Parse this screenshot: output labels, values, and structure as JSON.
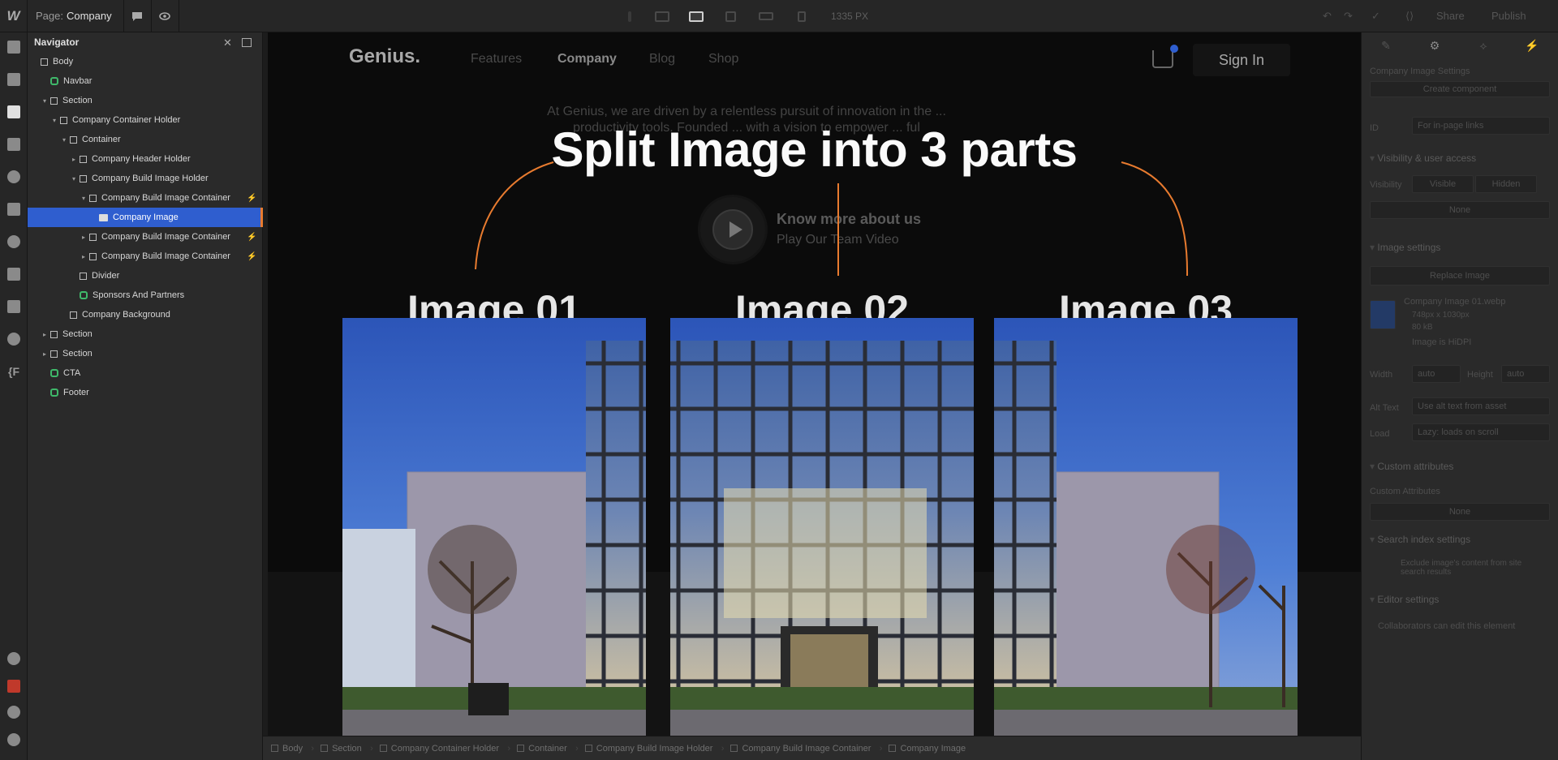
{
  "topbar": {
    "logo": "W",
    "page_prefix": "Page:",
    "page_name": "Company",
    "width_readout": "1335 PX",
    "share": "Share",
    "publish": "Publish"
  },
  "navigator": {
    "title": "Navigator",
    "tree": [
      {
        "label": "Body",
        "depth": 0,
        "kind": "box",
        "caret": ""
      },
      {
        "label": "Navbar",
        "depth": 1,
        "kind": "component",
        "caret": ""
      },
      {
        "label": "Section",
        "depth": 1,
        "kind": "box",
        "caret": "▾"
      },
      {
        "label": "Company Container Holder",
        "depth": 2,
        "kind": "box",
        "caret": "▾"
      },
      {
        "label": "Container",
        "depth": 3,
        "kind": "box",
        "caret": "▾"
      },
      {
        "label": "Company Header Holder",
        "depth": 4,
        "kind": "box",
        "caret": "▸"
      },
      {
        "label": "Company Build Image Holder",
        "depth": 4,
        "kind": "box",
        "caret": "▾"
      },
      {
        "label": "Company Build Image Container",
        "depth": 5,
        "kind": "box",
        "caret": "▾",
        "bolt": true
      },
      {
        "label": "Company Image",
        "depth": 6,
        "kind": "image",
        "caret": "",
        "selected": true
      },
      {
        "label": "Company Build Image Container",
        "depth": 5,
        "kind": "box",
        "caret": "▸",
        "bolt": true
      },
      {
        "label": "Company Build Image Container",
        "depth": 5,
        "kind": "box",
        "caret": "▸",
        "bolt": true
      },
      {
        "label": "Divider",
        "depth": 4,
        "kind": "box",
        "caret": ""
      },
      {
        "label": "Sponsors And Partners",
        "depth": 4,
        "kind": "component",
        "caret": ""
      },
      {
        "label": "Company Background",
        "depth": 3,
        "kind": "box",
        "caret": ""
      },
      {
        "label": "Section",
        "depth": 1,
        "kind": "box",
        "caret": "▸"
      },
      {
        "label": "Section",
        "depth": 1,
        "kind": "box",
        "caret": "▸"
      },
      {
        "label": "CTA",
        "depth": 1,
        "kind": "component",
        "caret": ""
      },
      {
        "label": "Footer",
        "depth": 1,
        "kind": "component",
        "caret": ""
      }
    ]
  },
  "site": {
    "logo": "Genius.",
    "links": [
      "Features",
      "Company",
      "Blog",
      "Shop"
    ],
    "current_link": "Company",
    "sign_in": "Sign In",
    "about_text": "At Genius, we are driven by a relentless pursuit of innovation in the ... productivity tools. Founded ... with a vision to empower ... ful",
    "know_title": "Know more about us",
    "know_sub": "Play Our Team Video"
  },
  "overlay": {
    "title": "Split Image into 3 parts",
    "labels": [
      "Image 01",
      "Image 02",
      "Image 03"
    ],
    "accent": "#e87b2f"
  },
  "breadcrumbs": [
    "Body",
    "Section",
    "Company Container Holder",
    "Container",
    "Company Build Image Holder",
    "Company Build Image Container",
    "Company Image"
  ],
  "right_panel": {
    "heading": "Company Image Settings",
    "create_component": "Create component",
    "id_label": "ID",
    "id_placeholder": "For in-page links",
    "visibility_section": "Visibility & user access",
    "visibility_label": "Visibility",
    "visible": "Visible",
    "hidden": "Hidden",
    "none1": "None",
    "image_section": "Image settings",
    "replace_image": "Replace Image",
    "file_name": "Company Image 01.webp",
    "file_dims": "748px x 1030px",
    "file_size": "80 kB",
    "hidpi": "Image is HiDPI",
    "width_label": "Width",
    "width_value": "auto",
    "height_label": "Height",
    "height_value": "auto",
    "alt_label": "Alt Text",
    "alt_value": "Use alt text from asset",
    "load_label": "Load",
    "load_value": "Lazy: loads on scroll",
    "custom_section": "Custom attributes",
    "custom_label": "Custom Attributes",
    "none2": "None",
    "search_section": "Search index settings",
    "search_text": "Exclude image's content from site search results",
    "editor_section": "Editor settings",
    "editor_text": "Collaborators can edit this element"
  },
  "colors": {
    "accent": "#e87b2f",
    "selection": "#2f5ecf",
    "component": "#3fb86a"
  }
}
